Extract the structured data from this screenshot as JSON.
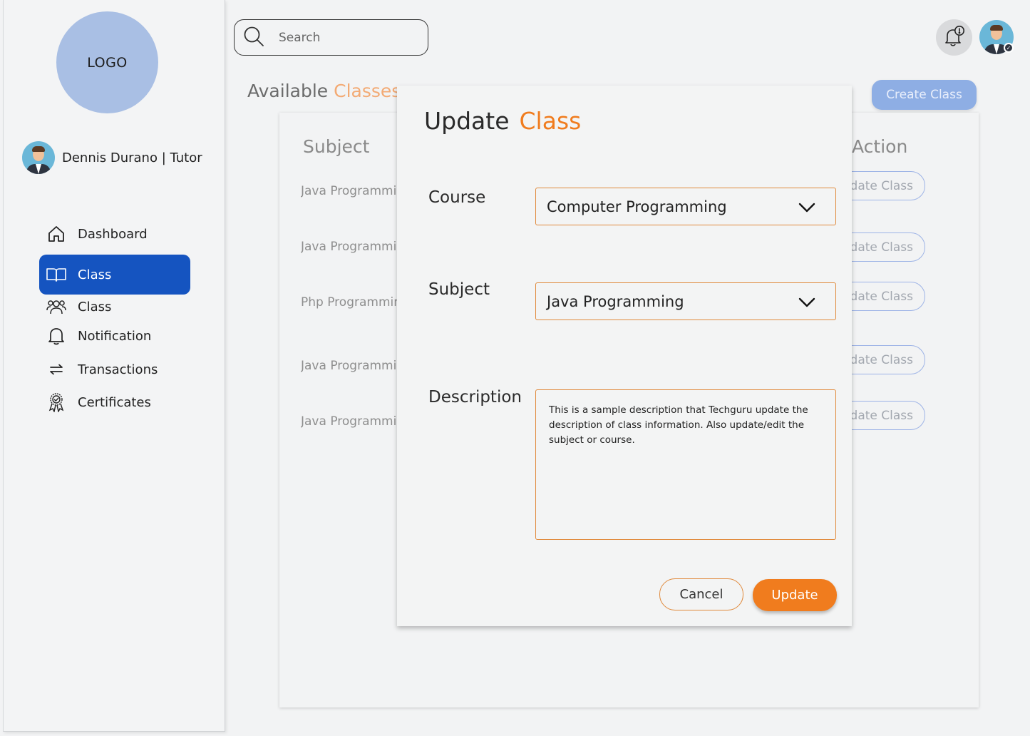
{
  "sidebar": {
    "logo_text": "LOGO",
    "profile_name": "Dennis Durano | Tutor",
    "nav": [
      {
        "label": "Dashboard",
        "icon": "home-icon"
      },
      {
        "label": "Class",
        "icon": "book-icon",
        "active": true
      },
      {
        "label": "Class",
        "icon": "users-icon"
      },
      {
        "label": "Notification",
        "icon": "bell-icon"
      },
      {
        "label": "Transactions",
        "icon": "arrows-icon"
      },
      {
        "label": "Certificates",
        "icon": "award-icon"
      }
    ]
  },
  "topbar": {
    "search_placeholder": "Search",
    "notification_icon": "bell-alert-icon",
    "avatar_icon": "user-avatar"
  },
  "page": {
    "title_part1": "Available",
    "title_part2": "Classes",
    "create_button": "Create Class",
    "columns": {
      "subject": "Subject",
      "action": "Action"
    },
    "rows": [
      {
        "subject": "Java Programming",
        "action": "Update Class"
      },
      {
        "subject": "Java Programming",
        "action": "Update Class"
      },
      {
        "subject": "Php Programming",
        "action": "Update Class"
      },
      {
        "subject": "Java Programming",
        "action": "Update Class"
      },
      {
        "subject": "Java Programming",
        "action": "Update Class"
      }
    ]
  },
  "modal": {
    "title_part1": "Update",
    "title_part2": "Class",
    "course_label": "Course",
    "course_value": "Computer Programming",
    "subject_label": "Subject",
    "subject_value": "Java Programming",
    "description_label": "Description",
    "description_value": "This is a sample description that Techguru update the description of class information. Also update/edit the subject or course.",
    "cancel_label": "Cancel",
    "update_label": "Update"
  },
  "colors": {
    "primary_blue": "#1554c0",
    "accent_orange": "#f07c1e",
    "logo_circle": "#a9bfe4"
  }
}
